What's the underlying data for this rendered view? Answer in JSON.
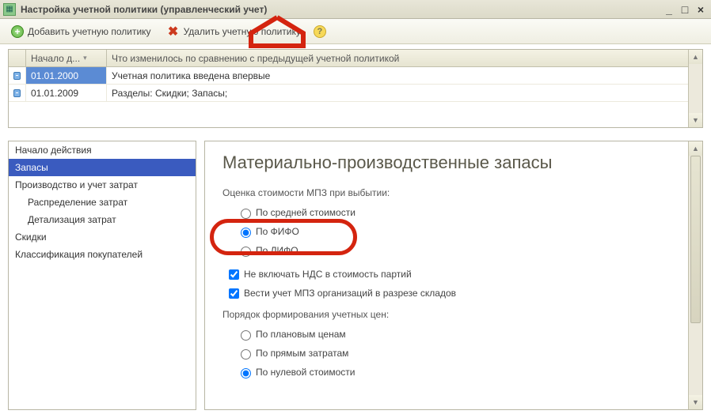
{
  "window": {
    "title": "Настройка учетной политики (управленческий учет)"
  },
  "toolbar": {
    "add_label": "Добавить учетную политику",
    "delete_label": "Удалить учетную политику"
  },
  "table": {
    "headers": {
      "start": "Начало д...",
      "changes": "Что изменилось по сравнению с предыдущей учетной политикой"
    },
    "rows": [
      {
        "date": "01.01.2000",
        "changes": "Учетная политика введена впервые"
      },
      {
        "date": "01.01.2009",
        "changes": "Разделы: Скидки; Запасы;"
      }
    ]
  },
  "sidebar": {
    "items": [
      {
        "label": "Начало действия",
        "indent": false
      },
      {
        "label": "Запасы",
        "indent": false,
        "selected": true
      },
      {
        "label": "Производство и учет затрат",
        "indent": false
      },
      {
        "label": "Распределение затрат",
        "indent": true
      },
      {
        "label": "Детализация затрат",
        "indent": true
      },
      {
        "label": "Скидки",
        "indent": false
      },
      {
        "label": "Классификация покупателей",
        "indent": false
      }
    ]
  },
  "content": {
    "heading": "Материально-производственные запасы",
    "cost_label": "Оценка стоимости МПЗ при выбытии:",
    "cost_options": [
      {
        "label": "По средней стоимости",
        "checked": false
      },
      {
        "label": "По ФИФО",
        "checked": true
      },
      {
        "label": "По ЛИФО",
        "checked": false
      }
    ],
    "checks": [
      {
        "label": "Не включать НДС в стоимость партий",
        "checked": true
      },
      {
        "label": "Вести учет МПЗ организаций в разрезе складов",
        "checked": true
      }
    ],
    "price_label": "Порядок формирования учетных цен:",
    "price_options": [
      {
        "label": "По плановым ценам",
        "checked": false
      },
      {
        "label": "По прямым затратам",
        "checked": false
      },
      {
        "label": "По нулевой стоимости",
        "checked": true
      }
    ]
  }
}
